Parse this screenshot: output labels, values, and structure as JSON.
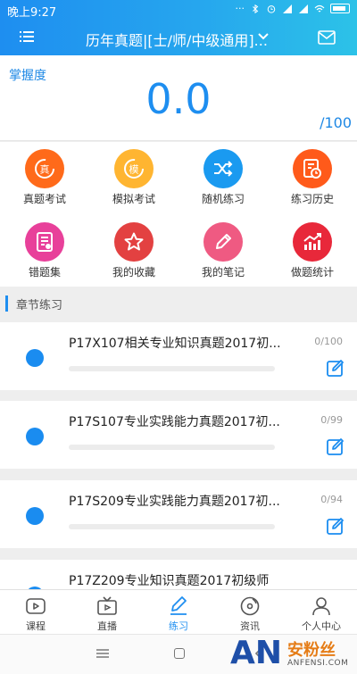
{
  "status_bar": {
    "time": "晚上9:27",
    "indicators": [
      "notification-dots",
      "bluetooth-icon",
      "alarm-icon",
      "signal-icon",
      "signal-icon",
      "wifi-icon",
      "battery-icon"
    ]
  },
  "header": {
    "title": "历年真题|[士/师/中级通用]...",
    "menu_icon": "menu-icon",
    "mail_icon": "mail-icon",
    "background": "#1e8ef0"
  },
  "score": {
    "label": "掌握度",
    "value": "0.0",
    "total": "/100"
  },
  "grid": [
    {
      "label": "真题考试",
      "icon": "zhen-icon",
      "color": "#ff6a1a"
    },
    {
      "label": "模拟考试",
      "icon": "mo-icon",
      "color": "#ffb531"
    },
    {
      "label": "随机练习",
      "icon": "shuffle-icon",
      "color": "#1a9af0"
    },
    {
      "label": "练习历史",
      "icon": "history-icon",
      "color": "#ff5a1a"
    },
    {
      "label": "错题集",
      "icon": "wrong-set-icon",
      "color": "#e8409a"
    },
    {
      "label": "我的收藏",
      "icon": "star-icon",
      "color": "#e34141"
    },
    {
      "label": "我的笔记",
      "icon": "pencil-icon",
      "color": "#ef5a82"
    },
    {
      "label": "做题统计",
      "icon": "stats-icon",
      "color": "#e8283a"
    }
  ],
  "section": {
    "title": "章节练习"
  },
  "chapters": [
    {
      "name": "P17X107相关专业知识真题2017初...",
      "count": "0/100",
      "progress": 0
    },
    {
      "name": "P17S107专业实践能力真题2017初...",
      "count": "0/99",
      "progress": 0
    },
    {
      "name": "P17S209专业实践能力真题2017初...",
      "count": "0/94",
      "progress": 0
    },
    {
      "name": "P17Z209专业知识真题2017初级师",
      "count": "",
      "progress": 0
    }
  ],
  "tabs": [
    {
      "label": "课程",
      "icon": "course-icon"
    },
    {
      "label": "直播",
      "icon": "tv-icon"
    },
    {
      "label": "练习",
      "icon": "pen-icon",
      "active": true
    },
    {
      "label": "资讯",
      "icon": "news-icon"
    },
    {
      "label": "个人中心",
      "icon": "user-icon"
    }
  ],
  "watermark": {
    "logo": "AN",
    "cn": "安粉丝",
    "en": "ANFENSI.COM"
  }
}
